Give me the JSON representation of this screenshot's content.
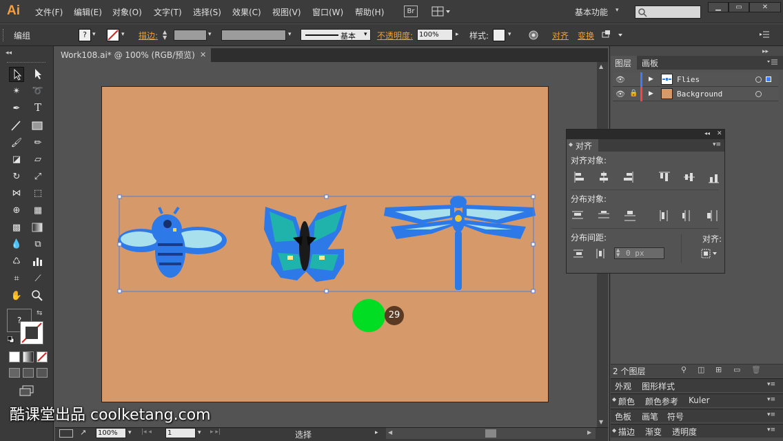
{
  "app": {
    "logo": "Ai"
  },
  "menu": [
    "文件(F)",
    "编辑(E)",
    "对象(O)",
    "文字(T)",
    "选择(S)",
    "效果(C)",
    "视图(V)",
    "窗口(W)",
    "帮助(H)"
  ],
  "bridge_label": "Br",
  "workspace": "基本功能",
  "control": {
    "object_type": "编组",
    "stroke_label": "描边:",
    "stroke_style_label": "基本",
    "opacity_label": "不透明度:",
    "opacity_value": "100%",
    "style_label": "样式:",
    "align_link": "对齐",
    "transform_link": "变换"
  },
  "document": {
    "tab_title": "Work108.ai* @ 100% (RGB/预览)"
  },
  "layers_panel": {
    "tabs": [
      "图层",
      "画板"
    ],
    "layers": [
      {
        "name": "Flies",
        "color": "#3d7bff"
      },
      {
        "name": "Background",
        "color": "#ff4040"
      }
    ],
    "footer": "2 个图层"
  },
  "align_panel": {
    "title": "对齐",
    "align_objects": "对齐对象:",
    "distribute_objects": "分布对象:",
    "distribute_spacing": "分布间距:",
    "align_to": "对齐:",
    "spacing_value": "0 px"
  },
  "stacked_panels": [
    {
      "tabs": [
        "外观",
        "图形样式"
      ]
    },
    {
      "tabs": [
        "颜色",
        "颜色参考",
        "Kuler"
      ]
    },
    {
      "tabs": [
        "色板",
        "画笔",
        "符号"
      ]
    },
    {
      "tabs": [
        "描边",
        "渐变",
        "透明度"
      ]
    }
  ],
  "status": {
    "zoom": "100%",
    "page": "1",
    "mode": "选择"
  },
  "step_badge": "29",
  "watermark": "酷课堂出品 coolketang.com",
  "colors": {
    "artboard": "#d5996a",
    "accent": "#f0a030",
    "selection": "#4a7fe0",
    "cursor": "#00dd22"
  }
}
